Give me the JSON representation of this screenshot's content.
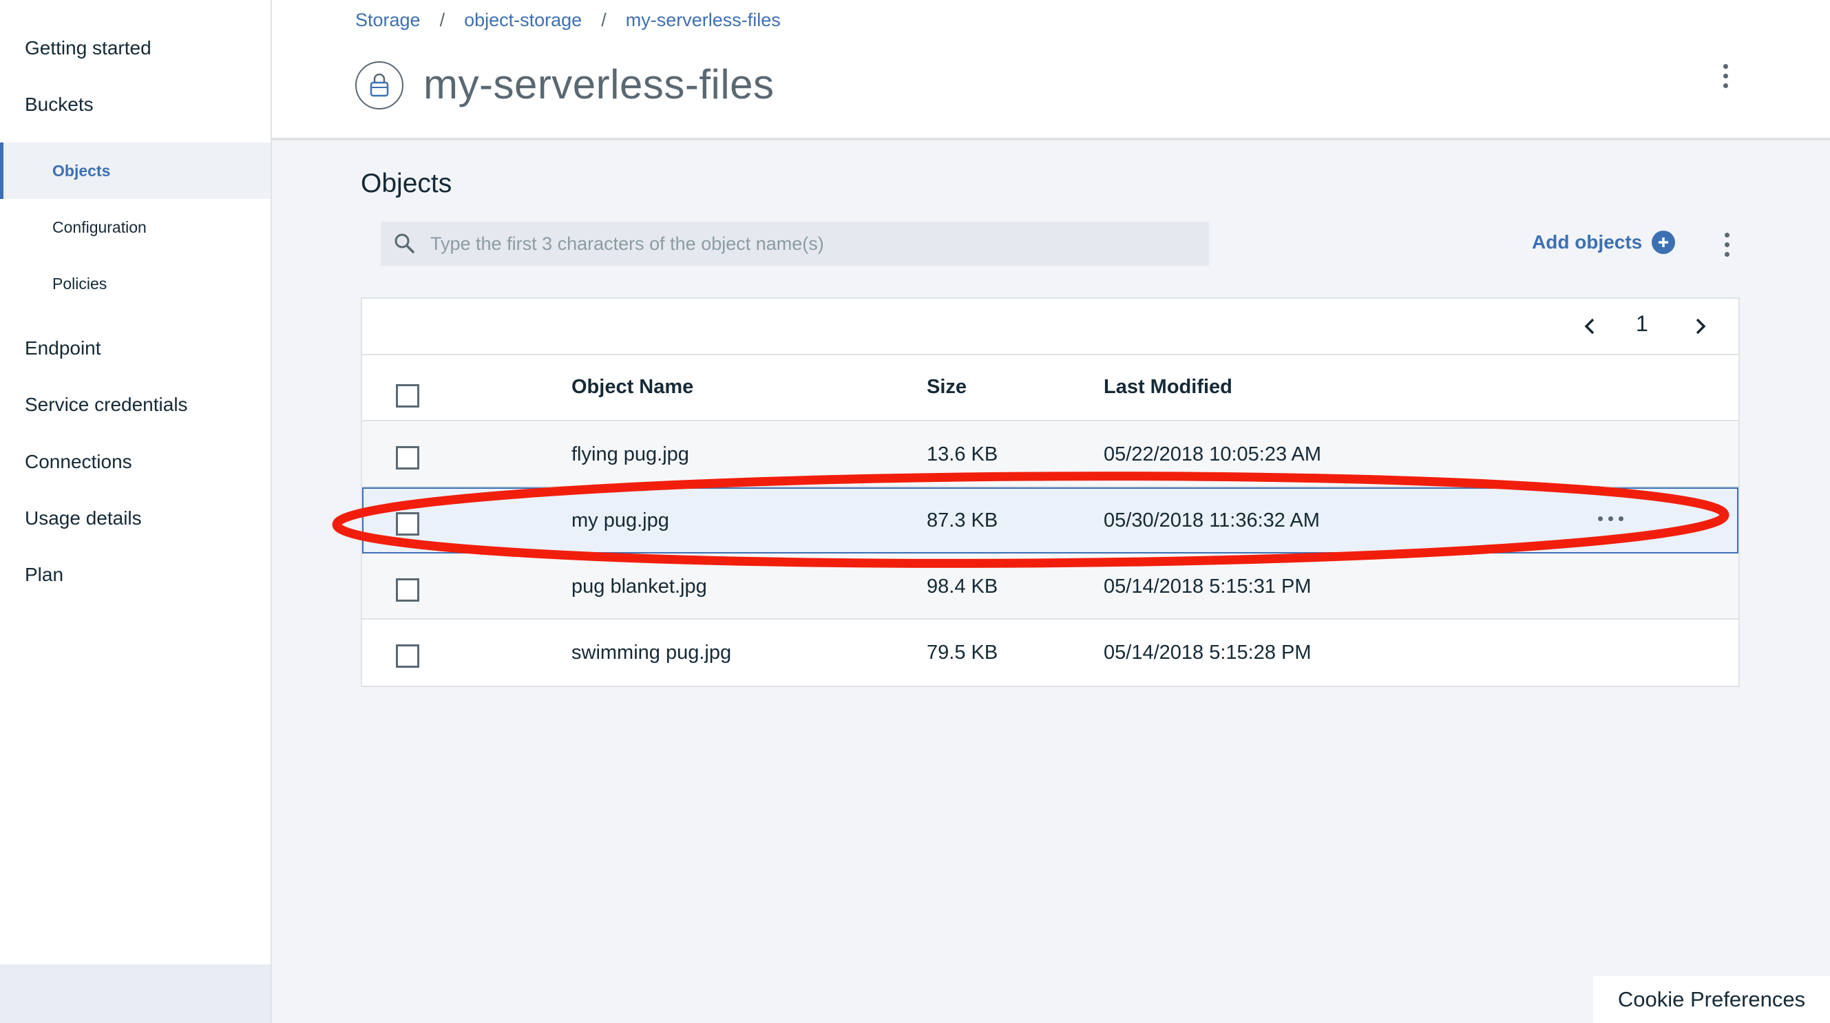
{
  "sidebar": {
    "items": [
      {
        "label": "Getting started"
      },
      {
        "label": "Buckets"
      },
      {
        "label": "Objects"
      },
      {
        "label": "Configuration"
      },
      {
        "label": "Policies"
      },
      {
        "label": "Endpoint"
      },
      {
        "label": "Service credentials"
      },
      {
        "label": "Connections"
      },
      {
        "label": "Usage details"
      },
      {
        "label": "Plan"
      }
    ],
    "active_item": "Objects"
  },
  "header": {
    "breadcrumb": [
      {
        "label": "Storage"
      },
      {
        "label": "object-storage"
      },
      {
        "label": "my-serverless-files"
      }
    ],
    "separator": "/",
    "title": "my-serverless-files",
    "bucket_icon": "bucket-lock-icon",
    "menu_icon": "overflow-menu-vertical-icon"
  },
  "objects": {
    "title": "Objects",
    "search": {
      "placeholder": "Type the first 3 characters of the object name(s)",
      "value": "",
      "icon": "search-icon"
    },
    "add_objects_label": "Add objects",
    "add_icon": "add-circle-icon",
    "menu_icon": "overflow-menu-vertical-icon"
  },
  "table": {
    "pagination": {
      "page": "1",
      "prev_icon": "chevron-left-icon",
      "next_icon": "chevron-right-icon"
    },
    "columns": [
      "Object Name",
      "Size",
      "Last Modified"
    ],
    "rows": [
      {
        "name": "flying pug.jpg",
        "size": "13.6 KB",
        "modified": "05/22/2018 10:05:23 AM"
      },
      {
        "name": "my pug.jpg",
        "size": "87.3 KB",
        "modified": "05/30/2018 11:36:32 AM"
      },
      {
        "name": "pug blanket.jpg",
        "size": "98.4 KB",
        "modified": "05/14/2018 5:15:31 PM"
      },
      {
        "name": "swimming pug.jpg",
        "size": "79.5 KB",
        "modified": "05/14/2018 5:15:28 PM"
      }
    ],
    "highlighted_row": "my pug.jpg",
    "row_menu_icon": "overflow-menu-horizontal-icon"
  },
  "annotation": {
    "shape": "ellipse",
    "color": "#f21e0c",
    "target": "my pug.jpg"
  },
  "cookie_preferences_label": "Cookie Preferences",
  "colors": {
    "accent": "#3d70b2",
    "text": "#152935",
    "muted": "#5a6872",
    "background": "#f2f4f8",
    "annotation": "#f21e0c"
  }
}
